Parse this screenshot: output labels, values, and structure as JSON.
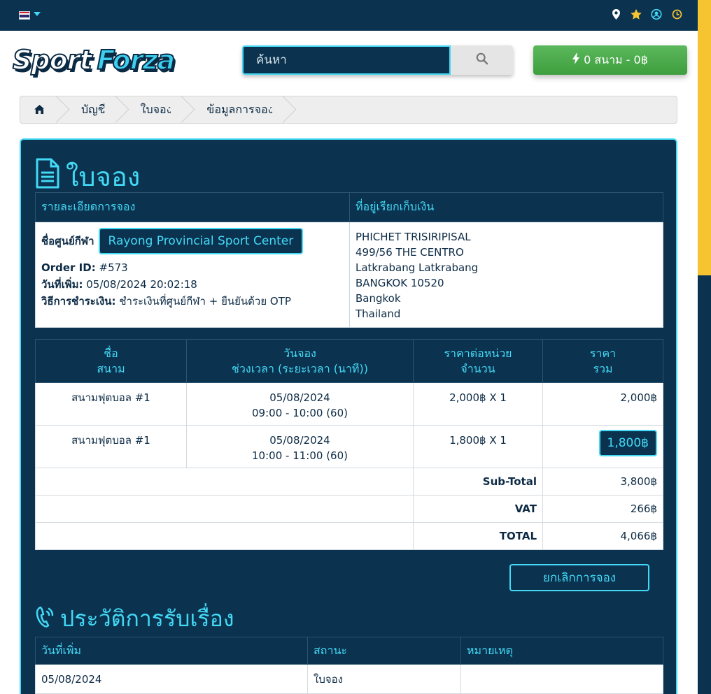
{
  "topbar": {
    "language": "TH",
    "icons": [
      "map-marker-icon",
      "star-icon",
      "user-circle-icon",
      "clock-icon"
    ]
  },
  "header": {
    "logo_word1": "Sport",
    "logo_word2": "Forza",
    "search_placeholder": "ค้นหา",
    "cart_label": "0 สนาม - 0฿"
  },
  "breadcrumb": {
    "items": [
      "บัญชี",
      "ใบจอง",
      "ข้อมูลการจอง"
    ]
  },
  "page": {
    "title": "ใบจอง"
  },
  "booking_info": {
    "details_header": "รายละเอียดการจอง",
    "billing_header": "ที่อยู่เรียกเก็บเงิน",
    "center_label": "ชื่อศูนย์กีฬา",
    "center_name": "Rayong Provincial Sport Center",
    "order_label": "Order ID:",
    "order_value": "#573",
    "date_label": "วันที่เพิ่ม:",
    "date_value": "05/08/2024 20:02:18",
    "payment_label": "วิธีการชำระเงิน:",
    "payment_value": "ชำระเงินที่ศูนย์กีฬา + ยืนยันด้วย OTP",
    "address": [
      "PHICHET TRISIRIPISAL",
      "499/56 THE CENTRO",
      "Latkrabang Latkrabang",
      "BANGKOK 10520",
      "Bangkok",
      "Thailand"
    ]
  },
  "items_table": {
    "headers": [
      {
        "line1": "ชื่อ",
        "line2": "สนาม"
      },
      {
        "line1": "วันจอง",
        "line2": "ช่วงเวลา (ระยะเวลา (นาที))"
      },
      {
        "line1": "ราคาต่อหน่วย",
        "line2": "จำนวน"
      },
      {
        "line1": "ราคา",
        "line2": "รวม"
      }
    ],
    "rows": [
      {
        "name": "สนามฟุตบอล #1",
        "date": "05/08/2024",
        "time": "09:00 - 10:00 (60)",
        "unit": "2,000฿ X 1",
        "total": "2,000฿"
      },
      {
        "name": "สนามฟุตบอล #1",
        "date": "05/08/2024",
        "time": "10:00 - 11:00 (60)",
        "unit": "1,800฿ X 1",
        "total": "1,800฿"
      }
    ],
    "subtotal_label": "Sub-Total",
    "subtotal_value": "3,800฿",
    "vat_label": "VAT",
    "vat_value": "266฿",
    "total_label": "TOTAL",
    "total_value": "4,066฿"
  },
  "cancel_label": "ยกเลิกการจอง",
  "history": {
    "title": "ประวัติการรับเรื่อง",
    "headers": [
      "วันที่เพิ่ม",
      "สถานะ",
      "หมายเหตุ"
    ],
    "rows": [
      {
        "date": "05/08/2024",
        "status": "ใบจอง",
        "note": ""
      }
    ]
  },
  "colors": {
    "navy": "#0b3350",
    "cyan": "#43d9f5",
    "green": "#4cae4c",
    "scroll_thumb": "#f7c431"
  }
}
